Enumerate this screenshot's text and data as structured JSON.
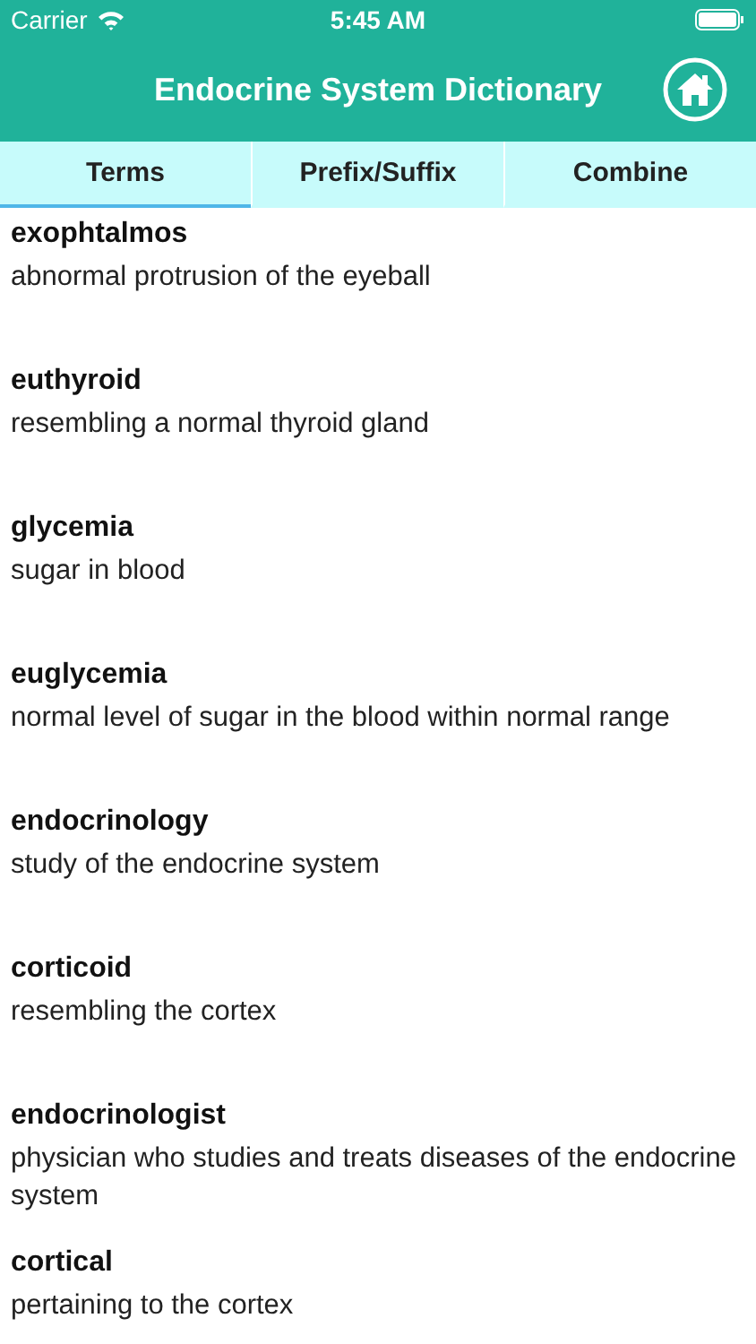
{
  "status_bar": {
    "carrier": "Carrier",
    "time": "5:45 AM"
  },
  "header": {
    "title": "Endocrine System Dictionary"
  },
  "tabs": [
    {
      "label": "Terms",
      "selected": true
    },
    {
      "label": "Prefix/Suffix",
      "selected": false
    },
    {
      "label": "Combine",
      "selected": false
    }
  ],
  "entries": [
    {
      "term": "exophtalmos",
      "definition": "abnormal protrusion of the eyeball"
    },
    {
      "term": "euthyroid",
      "definition": "resembling a normal thyroid gland"
    },
    {
      "term": "glycemia",
      "definition": "sugar in blood"
    },
    {
      "term": "euglycemia",
      "definition": "normal level of sugar in the blood within normal range"
    },
    {
      "term": "endocrinology",
      "definition": "study of the endocrine system"
    },
    {
      "term": "corticoid",
      "definition": "resembling the cortex"
    },
    {
      "term": "endocrinologist",
      "definition": "physician who studies and treats diseases of the endocrine system"
    },
    {
      "term": "cortical",
      "definition": "pertaining to the cortex"
    }
  ]
}
